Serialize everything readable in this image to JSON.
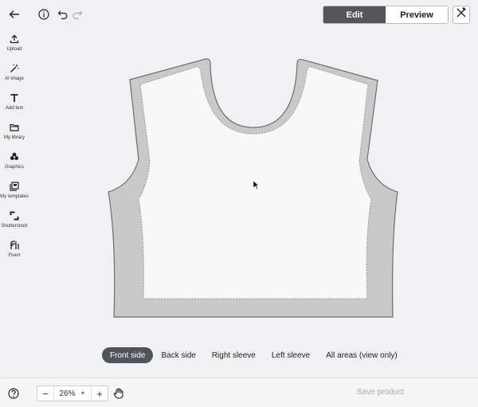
{
  "toolbar": {
    "back_icon": "arrow-left-icon",
    "info_icon": "info-icon",
    "undo_icon": "undo-icon",
    "redo_icon": "redo-icon",
    "edit_label": "Edit",
    "preview_label": "Preview",
    "close_icon": "tools-close-icon",
    "active_mode": "Edit"
  },
  "sidebar": {
    "items": [
      {
        "label": "Upload",
        "icon": "upload-icon"
      },
      {
        "label": "AI image",
        "icon": "magic-wand-icon"
      },
      {
        "label": "Add text",
        "icon": "text-icon"
      },
      {
        "label": "My library",
        "icon": "folder-icon"
      },
      {
        "label": "Graphics",
        "icon": "shapes-icon"
      },
      {
        "label": "My templates",
        "icon": "templates-icon"
      },
      {
        "label": "Shutterstock",
        "icon": "shutterstock-icon"
      },
      {
        "label": "Fiverr",
        "icon": "fiverr-icon"
      }
    ]
  },
  "tabs": {
    "items": [
      "Front side",
      "Back side",
      "Right sleeve",
      "Left sleeve",
      "All areas (view only)"
    ],
    "active": "Front side"
  },
  "bottom": {
    "help_icon": "help-icon",
    "zoom_value": "26%",
    "zoom_minus": "−",
    "zoom_plus": "+",
    "hand_icon": "hand-icon",
    "save_label": "Save product"
  },
  "colors": {
    "active_seg": "#555558",
    "active_tab": "#4f555d",
    "garment_border": "#c9c9c9",
    "garment_fill": "#f7f7f7",
    "disabled_text": "#aaaaaa"
  }
}
